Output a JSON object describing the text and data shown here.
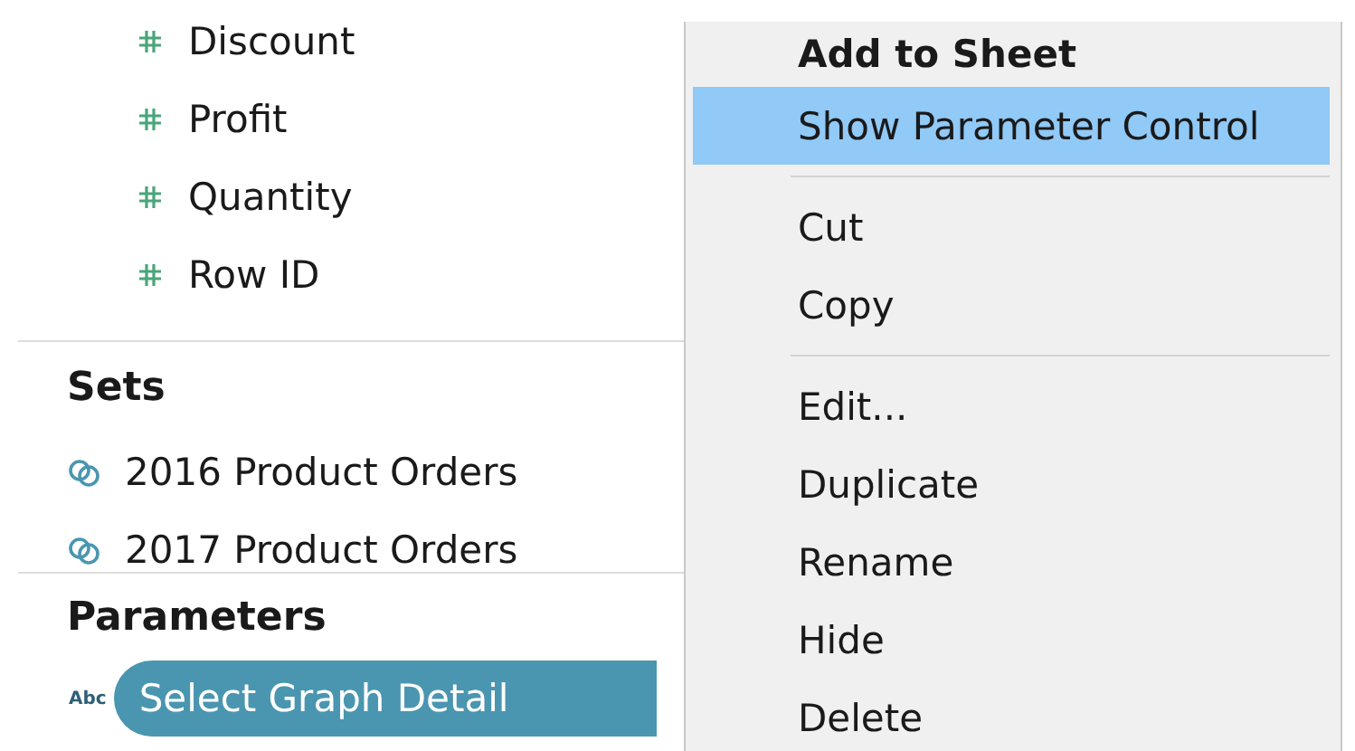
{
  "measures": [
    {
      "label": "Discount"
    },
    {
      "label": "Profit"
    },
    {
      "label": "Quantity"
    },
    {
      "label": "Row ID"
    }
  ],
  "sets": {
    "title": "Sets",
    "items": [
      {
        "label": "2016 Product Orders"
      },
      {
        "label": "2017 Product Orders"
      }
    ]
  },
  "parameters": {
    "title": "Parameters",
    "items": [
      {
        "type": "Abc",
        "label": "Select Graph Detail",
        "selected": true
      }
    ]
  },
  "context_menu": {
    "items": [
      {
        "kind": "item",
        "label": "Add to Sheet",
        "bold": true,
        "selected": false
      },
      {
        "kind": "item",
        "label": "Show Parameter Control",
        "bold": false,
        "selected": true
      },
      {
        "kind": "separator"
      },
      {
        "kind": "item",
        "label": "Cut",
        "bold": false,
        "selected": false
      },
      {
        "kind": "item",
        "label": "Copy",
        "bold": false,
        "selected": false
      },
      {
        "kind": "separator"
      },
      {
        "kind": "item",
        "label": "Edit...",
        "bold": false,
        "selected": false
      },
      {
        "kind": "item",
        "label": "Duplicate",
        "bold": false,
        "selected": false
      },
      {
        "kind": "item",
        "label": "Rename",
        "bold": false,
        "selected": false
      },
      {
        "kind": "item",
        "label": "Hide",
        "bold": false,
        "selected": false
      },
      {
        "kind": "item",
        "label": "Delete",
        "bold": false,
        "selected": false
      }
    ]
  }
}
